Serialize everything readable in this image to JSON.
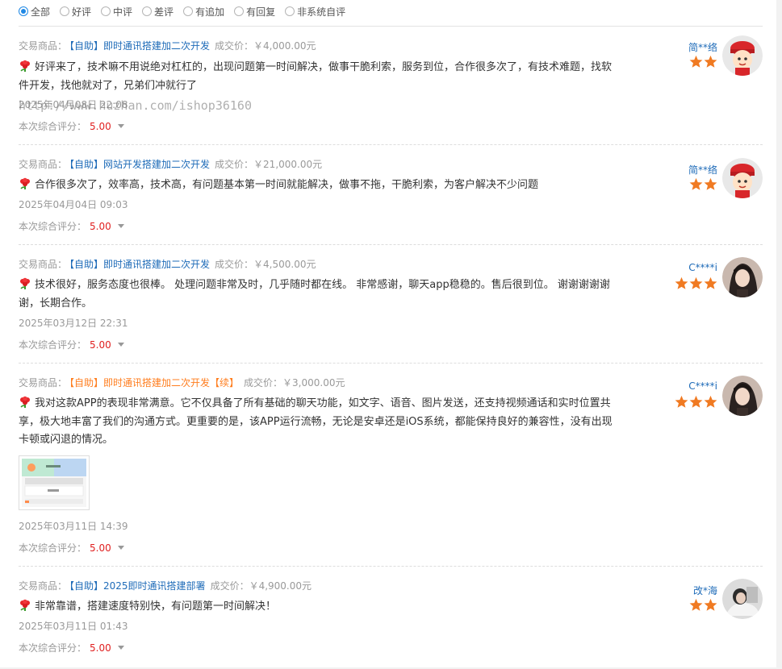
{
  "filters": [
    {
      "label": "全部",
      "checked": true
    },
    {
      "label": "好评",
      "checked": false
    },
    {
      "label": "中评",
      "checked": false
    },
    {
      "label": "差评",
      "checked": false
    },
    {
      "label": "有追加",
      "checked": false
    },
    {
      "label": "有回复",
      "checked": false
    },
    {
      "label": "非系统自评",
      "checked": false
    }
  ],
  "watermark": "http://www.huzhan.com/ishop36160",
  "product_label": "交易商品：",
  "price_label": "成交价：",
  "score_label": "本次综合评分：",
  "colors": {
    "accent": "#1e88e5",
    "link": "#1e6bb8",
    "star": "#f07a22",
    "score": "#e02020",
    "append": "#ff7e1f"
  },
  "reviews": [
    {
      "product": "【自助】即时通讯搭建加二次开发",
      "price": "￥4,000.00元",
      "comment": "好评来了，技术嘛不用说绝对杠杠的，出现问题第一时间解决，做事干脆利索，服务到位，合作很多次了，有技术难题，找软件开发，找他就对了，兄弟们冲就行了",
      "date": "2025年04月08日 22:08",
      "score": "5.00",
      "user": "简**络",
      "stars": 2,
      "avatar": "avatar-cartoon"
    },
    {
      "product": "【自助】网站开发搭建加二次开发",
      "price": "￥21,000.00元",
      "comment": "合作很多次了，效率高，技术高，有问题基本第一时间就能解决，做事不拖，干脆利索，为客户解决不少问题",
      "date": "2025年04月04日 09:03",
      "score": "5.00",
      "user": "简**络",
      "stars": 2,
      "avatar": "avatar-cartoon"
    },
    {
      "product": "【自助】即时通讯搭建加二次开发",
      "price": "￥4,500.00元",
      "comment": "技术很好，服务态度也很棒。 处理问题非常及时，几乎随时都在线。 非常感谢，聊天app稳稳的。售后很到位。 谢谢谢谢谢谢，长期合作。",
      "date": "2025年03月12日 22:31",
      "score": "5.00",
      "user": "C****i",
      "stars": 3,
      "avatar": "avatar-photo"
    },
    {
      "product": "【自助】即时通讯搭建加二次开发【续】",
      "price": "￥3,000.00元",
      "comment": "我对这款APP的表现非常满意。它不仅具备了所有基础的聊天功能，如文字、语音、图片发送，还支持视频通话和实时位置共享，极大地丰富了我们的沟通方式。更重要的是，该APP运行流畅，无论是安卓还是iOS系统，都能保持良好的兼容性，没有出现卡顿或闪退的情况。",
      "date": "2025年03月11日 14:39",
      "score": "5.00",
      "user": "C****i",
      "stars": 3,
      "avatar": "avatar-photo"
    },
    {
      "product": "【自助】2025即时通讯搭建部署",
      "price": "￥4,900.00元",
      "comment": "非常靠谱，搭建速度特别快，有问题第一时间解决！",
      "date": "2025年03月11日 01:43",
      "score": "5.00",
      "user": "改*海",
      "stars": 2,
      "avatar": "avatar-photo"
    }
  ]
}
